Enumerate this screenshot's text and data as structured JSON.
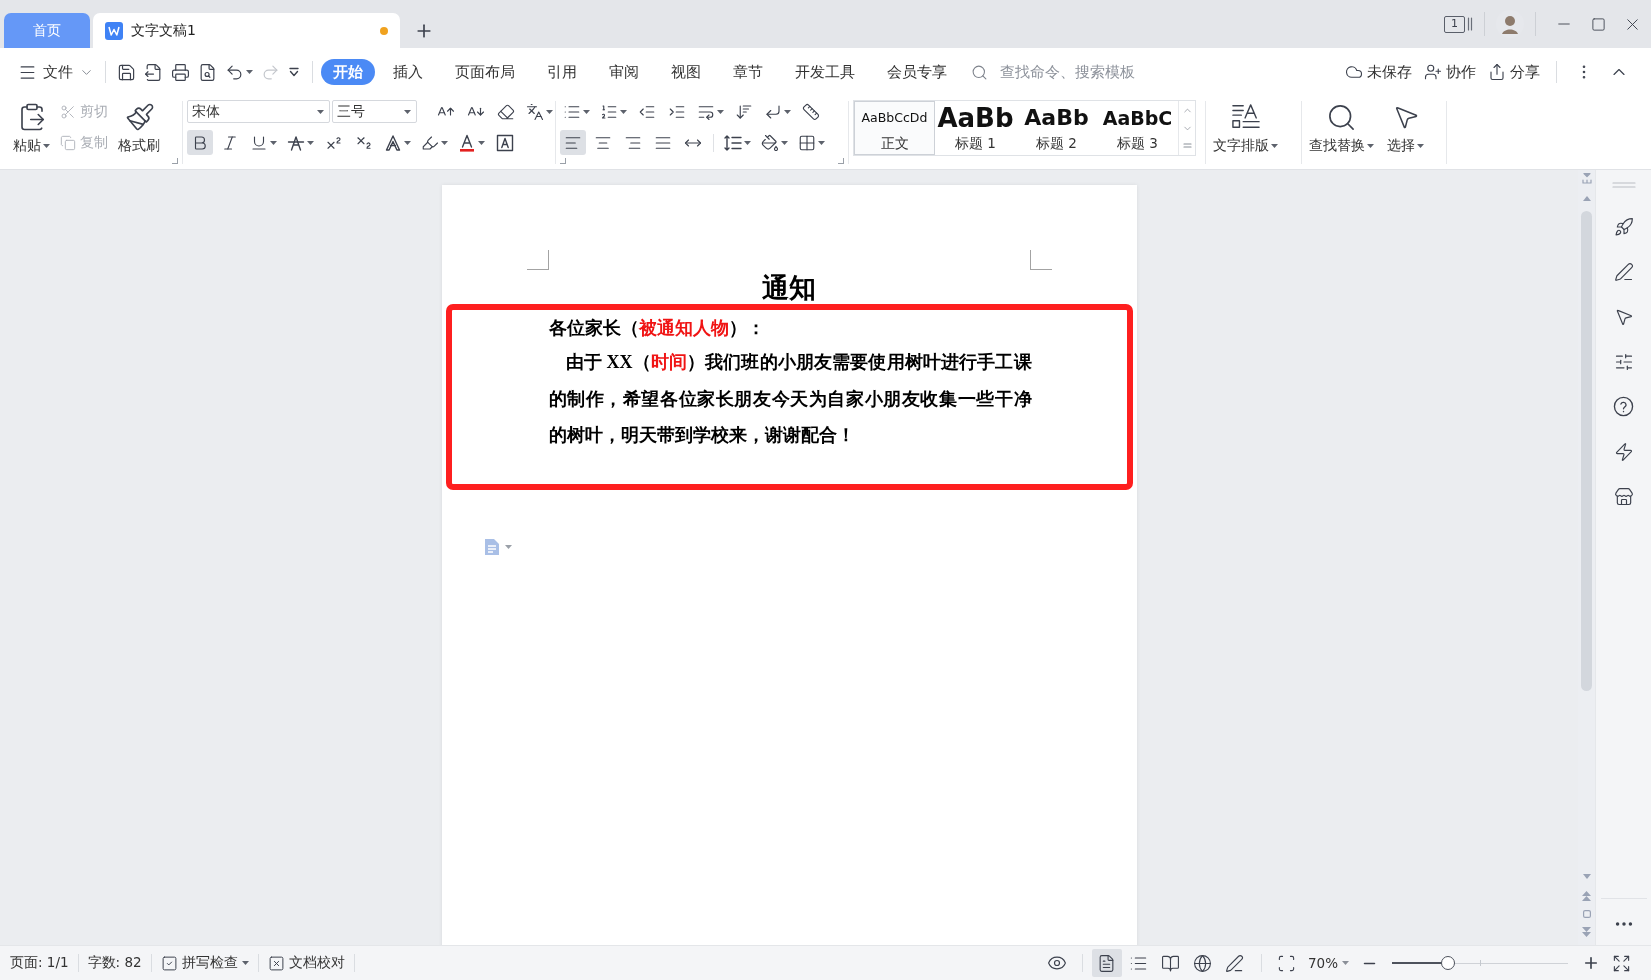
{
  "tabs": [
    {
      "kind": "home",
      "label": "首页",
      "selected": false
    },
    {
      "kind": "document",
      "label": "文字文稿1",
      "selected": true,
      "unsaved": true
    }
  ],
  "title_bar": {
    "window_count": "1"
  },
  "menu_bar": {
    "file": "文件",
    "quick_access": [
      {
        "kind": "save",
        "disabled": false
      },
      {
        "kind": "export",
        "disabled": false
      },
      {
        "kind": "print",
        "disabled": false
      },
      {
        "kind": "preview",
        "disabled": false
      },
      {
        "kind": "undo",
        "disabled": false,
        "dropdown": true
      },
      {
        "kind": "redo",
        "disabled": true
      },
      {
        "kind": "customize",
        "disabled": false
      }
    ],
    "tabs": [
      {
        "label": "开始",
        "selected": true
      },
      {
        "label": "插入",
        "selected": false
      },
      {
        "label": "页面布局",
        "selected": false
      },
      {
        "label": "引用",
        "selected": false
      },
      {
        "label": "审阅",
        "selected": false
      },
      {
        "label": "视图",
        "selected": false
      },
      {
        "label": "章节",
        "selected": false
      },
      {
        "label": "开发工具",
        "selected": false
      },
      {
        "label": "会员专享",
        "selected": false
      }
    ],
    "search": {
      "placeholder": "查找命令、搜索模板"
    },
    "actions": [
      {
        "kind": "cloud",
        "label": "未保存"
      },
      {
        "kind": "collaborate",
        "label": "协作"
      },
      {
        "kind": "share",
        "label": "分享"
      }
    ]
  },
  "ribbon": {
    "clipboard": {
      "paste": "粘贴",
      "cut": {
        "label": "剪切",
        "disabled": true
      },
      "copy": {
        "label": "复制",
        "disabled": true
      },
      "format_painter": "格式刷"
    },
    "font": {
      "family": "宋体",
      "size": "三号",
      "row_1": [
        {
          "kind": "grow",
          "selected": false
        },
        {
          "kind": "shrink",
          "selected": false
        },
        {
          "kind": "clear",
          "selected": false
        },
        {
          "kind": "pinyin",
          "selected": false,
          "dropdown": true
        }
      ],
      "row_2": [
        {
          "kind": "bold",
          "selected": true
        },
        {
          "kind": "italic",
          "selected": false
        },
        {
          "kind": "underline",
          "selected": false,
          "dropdown": true
        },
        {
          "kind": "strikethrough",
          "selected": false,
          "dropdown": true
        },
        {
          "kind": "superscript",
          "selected": false
        },
        {
          "kind": "subscript",
          "selected": false
        },
        {
          "kind": "text_effect",
          "selected": false,
          "dropdown": true
        },
        {
          "kind": "highlight",
          "selected": false,
          "dropdown": true
        },
        {
          "kind": "font_color",
          "selected": false,
          "dropdown": true
        },
        {
          "kind": "char_border",
          "selected": false
        }
      ]
    },
    "paragraph": {
      "row_1": [
        {
          "kind": "bullets",
          "selected": false,
          "dropdown": true
        },
        {
          "kind": "numbering",
          "selected": false,
          "dropdown": true
        },
        {
          "kind": "outdent",
          "selected": false
        },
        {
          "kind": "indent",
          "selected": false
        },
        {
          "kind": "chinese_layout",
          "selected": false,
          "dropdown": true
        },
        {
          "kind": "sort",
          "selected": false
        },
        {
          "kind": "marks",
          "selected": false,
          "dropdown": true
        },
        {
          "kind": "tab_stops",
          "selected": false
        }
      ],
      "row_2": [
        {
          "kind": "align_left",
          "selected": true
        },
        {
          "kind": "align_center",
          "selected": false
        },
        {
          "kind": "align_right",
          "selected": false
        },
        {
          "kind": "justify",
          "selected": false
        },
        {
          "kind": "distribute",
          "selected": false
        },
        {
          "kind": "line_spacing",
          "selected": false,
          "dropdown": true
        },
        {
          "kind": "shading",
          "selected": false,
          "dropdown": true
        },
        {
          "kind": "borders",
          "selected": false,
          "dropdown": true
        }
      ]
    },
    "styles": [
      {
        "kind": "normal",
        "preview": "AaBbCcDd",
        "label": "正文",
        "selected": true
      },
      {
        "kind": "heading1",
        "preview": "AaBb",
        "label": "标题 1",
        "selected": false
      },
      {
        "kind": "heading2",
        "preview": "AaBb",
        "label": "标题 2",
        "selected": false
      },
      {
        "kind": "heading3",
        "preview": "AaBbC",
        "label": "标题 3",
        "selected": false
      }
    ],
    "tools": [
      {
        "kind": "text_layout",
        "label": "文字排版",
        "dropdown": true
      },
      {
        "kind": "find_replace",
        "label": "查找替换",
        "dropdown": true
      },
      {
        "kind": "select",
        "label": "选择",
        "dropdown": true
      }
    ]
  },
  "document": {
    "title": "通知",
    "greeting": [
      {
        "text": "各位家长（",
        "highlighted": false
      },
      {
        "text": "被通知人物",
        "highlighted": true
      },
      {
        "text": "）：",
        "highlighted": false
      }
    ],
    "body_lines": [
      [
        {
          "text": "由于 XX（",
          "highlighted": false
        },
        {
          "text": "时间",
          "highlighted": true
        },
        {
          "text": "）我们班的小朋友需要使用树叶进行手工课",
          "highlighted": false
        }
      ],
      [
        {
          "text": "的制作，希望各位家长朋友今天为自家小朋友收集一些干净",
          "highlighted": false
        }
      ],
      [
        {
          "text": "的树叶，明天带到学校来，谢谢配合！",
          "highlighted": false
        }
      ]
    ]
  },
  "status_bar": {
    "page": "页面: 1/1",
    "word_count": "字数: 82",
    "spell_check": {
      "label": "拼写检查",
      "dropdown": true
    },
    "proofread": "文档校对",
    "views": [
      {
        "kind": "page",
        "selected": true
      },
      {
        "kind": "outline",
        "selected": false
      },
      {
        "kind": "reading",
        "selected": false
      },
      {
        "kind": "web",
        "selected": false
      },
      {
        "kind": "write",
        "selected": false
      }
    ],
    "zoom": "70%",
    "zoom_slider": {
      "level": 0.32
    }
  }
}
